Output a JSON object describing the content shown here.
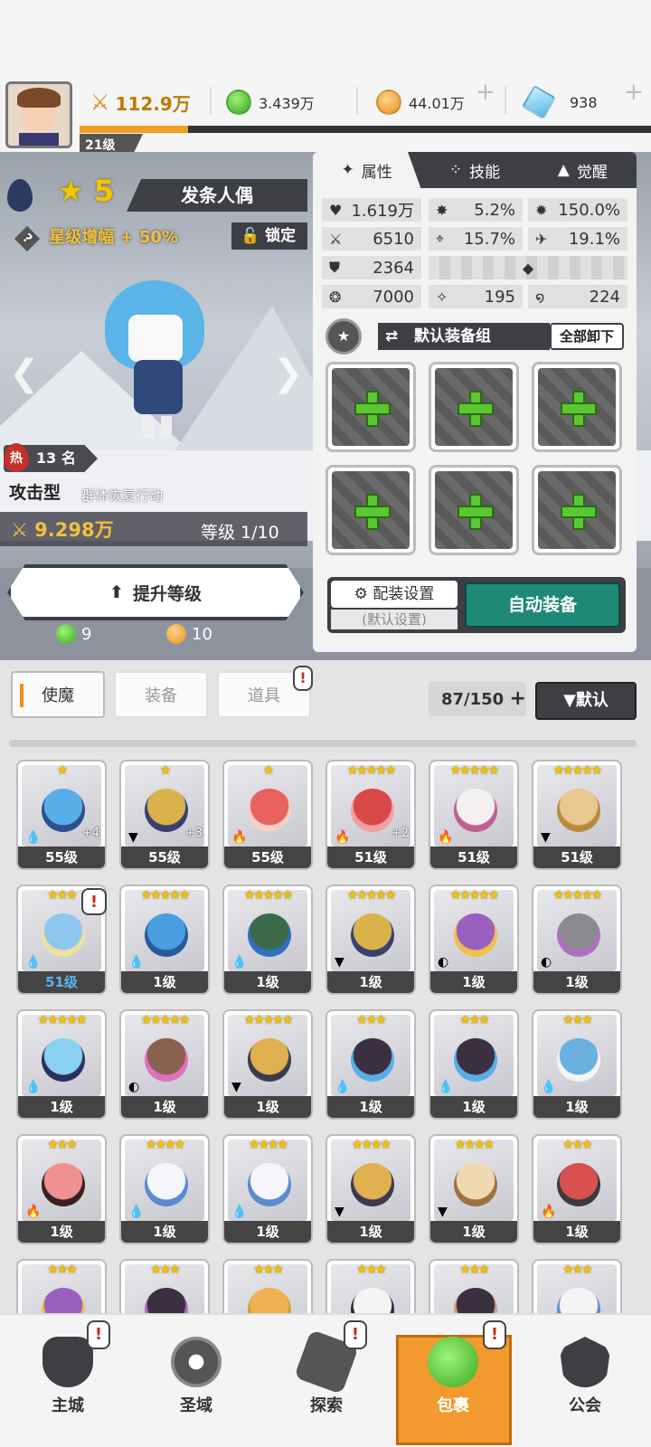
{
  "top": {
    "level": "21级",
    "power": "112.9万",
    "green_gem": "3.439万",
    "gold_coin": "44.01万",
    "diamond": "938",
    "xp_fraction": 0.19
  },
  "hero": {
    "element_icon": "water-drop-icon",
    "stars": "5",
    "name": "发条人偶",
    "star_bonus": "星级增幅 + 50%",
    "lock": "锁定",
    "hot_label": "热",
    "rank": "13 名",
    "type": "攻击型",
    "trait": "群体恢复行动",
    "power": "9.298万",
    "level": "等级 1/10",
    "upgrade_button": "提升等级",
    "cost_green": "9",
    "cost_gold": "10"
  },
  "panel": {
    "tabs": [
      "属性",
      "技能",
      "觉醒"
    ],
    "stats": {
      "hp": "1.619万",
      "crit": "5.2%",
      "crit_dmg": "150.0%",
      "atk": "6510",
      "accuracy": "15.7%",
      "speed": "19.1%",
      "def": "2364",
      "magic": "7000",
      "res1": "195",
      "res2": "224"
    },
    "equip_group": "默认装备组",
    "unequip_all": "全部卸下",
    "loadout": "配装设置",
    "loadout_sub": "(默认设置)",
    "auto_equip": "自动装备"
  },
  "inventory": {
    "tabs": [
      "使魔",
      "装备",
      "道具"
    ],
    "count": "87/150",
    "sort": "▼默认",
    "cards": [
      {
        "stars": "★",
        "lv": "55级",
        "plus": "+4",
        "el": "💧",
        "c1": "#5aaee8",
        "c2": "#2c4f8e"
      },
      {
        "stars": "★",
        "lv": "55级",
        "plus": "+3",
        "el": "▼",
        "c1": "#d9b24a",
        "c2": "#3a3f70"
      },
      {
        "stars": "★",
        "lv": "55级",
        "plus": "",
        "el": "🔥",
        "c1": "#e86060",
        "c2": "#f3d1c0"
      },
      {
        "stars": "★★★★★",
        "lv": "51级",
        "plus": "+2",
        "el": "🔥",
        "c1": "#d84848",
        "c2": "#f0a0a0"
      },
      {
        "stars": "★★★★★",
        "lv": "51级",
        "plus": "",
        "el": "🔥",
        "c1": "#f4f0f0",
        "c2": "#c06090"
      },
      {
        "stars": "★★★★★",
        "lv": "51级",
        "plus": "",
        "el": "▼",
        "c1": "#e8c890",
        "c2": "#b88a40"
      },
      {
        "stars": "★★★",
        "lv": "51级",
        "plus": "",
        "el": "💧",
        "c1": "#8cc8f0",
        "c2": "#f0e0a0"
      },
      {
        "stars": "★★★★★",
        "lv": "1级",
        "plus": "",
        "el": "💧",
        "c1": "#4a9ee0",
        "c2": "#2a5a9e"
      },
      {
        "stars": "★★★★★",
        "lv": "1级",
        "plus": "",
        "el": "💧",
        "c1": "#3a6a4a",
        "c2": "#3070c0"
      },
      {
        "stars": "★★★★★",
        "lv": "1级",
        "plus": "",
        "el": "▼",
        "c1": "#d9b24a",
        "c2": "#3a3f70"
      },
      {
        "stars": "★★★★★",
        "lv": "1级",
        "plus": "",
        "el": "◐",
        "c1": "#9a60c0",
        "c2": "#f0c050"
      },
      {
        "stars": "★★★★★",
        "lv": "1级",
        "plus": "",
        "el": "◐",
        "c1": "#8a8a90",
        "c2": "#b070c0"
      },
      {
        "stars": "★★★★★",
        "lv": "1级",
        "plus": "",
        "el": "💧",
        "c1": "#8ad0f0",
        "c2": "#2a3060"
      },
      {
        "stars": "★★★★★",
        "lv": "1级",
        "plus": "",
        "el": "◐",
        "c1": "#8a6050",
        "c2": "#e070c0"
      },
      {
        "stars": "★★★★★",
        "lv": "1级",
        "plus": "",
        "el": "▼",
        "c1": "#e0b050",
        "c2": "#3a3a50"
      },
      {
        "stars": "★★★",
        "lv": "1级",
        "plus": "",
        "el": "💧",
        "c1": "#3a3040",
        "c2": "#5aaee8"
      },
      {
        "stars": "★★★",
        "lv": "1级",
        "plus": "",
        "el": "💧",
        "c1": "#3a3040",
        "c2": "#5aaee8"
      },
      {
        "stars": "★★★",
        "lv": "1级",
        "plus": "",
        "el": "💧",
        "c1": "#6ab0e0",
        "c2": "#f4f4f4"
      },
      {
        "stars": "★★★",
        "lv": "1级",
        "plus": "",
        "el": "🔥",
        "c1": "#f09090",
        "c2": "#3a2020"
      },
      {
        "stars": "★★★★",
        "lv": "1级",
        "plus": "",
        "el": "💧",
        "c1": "#f6f6fa",
        "c2": "#5a8ad0"
      },
      {
        "stars": "★★★★",
        "lv": "1级",
        "plus": "",
        "el": "💧",
        "c1": "#f6f6fa",
        "c2": "#5a8ad0"
      },
      {
        "stars": "★★★★",
        "lv": "1级",
        "plus": "",
        "el": "▼",
        "c1": "#e0b050",
        "c2": "#3a3a50"
      },
      {
        "stars": "★★★★",
        "lv": "1级",
        "plus": "",
        "el": "▼",
        "c1": "#f0d8b0",
        "c2": "#a07040"
      },
      {
        "stars": "★★★",
        "lv": "1级",
        "plus": "",
        "el": "🔥",
        "c1": "#d85050",
        "c2": "#3a3a40"
      },
      {
        "stars": "★★★",
        "lv": "",
        "plus": "",
        "el": "",
        "c1": "#9a60c0",
        "c2": "#f0c050"
      },
      {
        "stars": "★★★",
        "lv": "",
        "plus": "",
        "el": "",
        "c1": "#3a3040",
        "c2": "#b070c0"
      },
      {
        "stars": "★★★",
        "lv": "",
        "plus": "",
        "el": "",
        "c1": "#f0b050",
        "c2": "#d0a040"
      },
      {
        "stars": "★★★",
        "lv": "",
        "plus": "",
        "el": "",
        "c1": "#f4f4f4",
        "c2": "#2a2a3a"
      },
      {
        "stars": "★★★",
        "lv": "",
        "plus": "",
        "el": "",
        "c1": "#3a3040",
        "c2": "#d0a080"
      },
      {
        "stars": "★★★",
        "lv": "",
        "plus": "",
        "el": "",
        "c1": "#f4f4f4",
        "c2": "#5a8ad0"
      }
    ]
  },
  "nav": [
    "主城",
    "圣域",
    "探索",
    "包裹",
    "公会"
  ]
}
